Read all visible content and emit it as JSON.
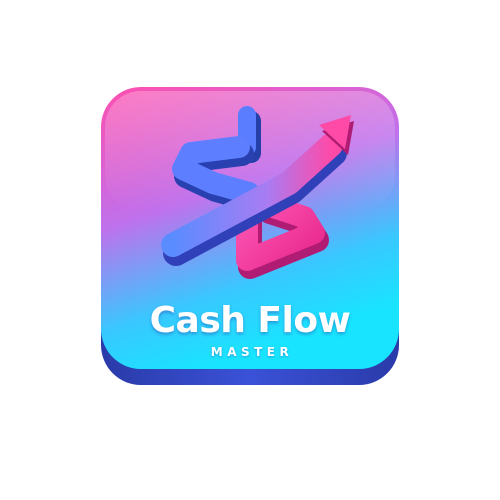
{
  "app_icon": {
    "title": "Cash Flow",
    "subtitle": "MASTER",
    "symbol": "dollar-arrow-icon",
    "colors": {
      "gradient_top": "#ff4fae",
      "gradient_mid": "#b67cf0",
      "gradient_bottom": "#19e4ff",
      "base_edge": "#3038b8",
      "symbol_pink": "#ff3da0",
      "symbol_blue": "#4f7dff",
      "text": "#ffffff"
    }
  }
}
